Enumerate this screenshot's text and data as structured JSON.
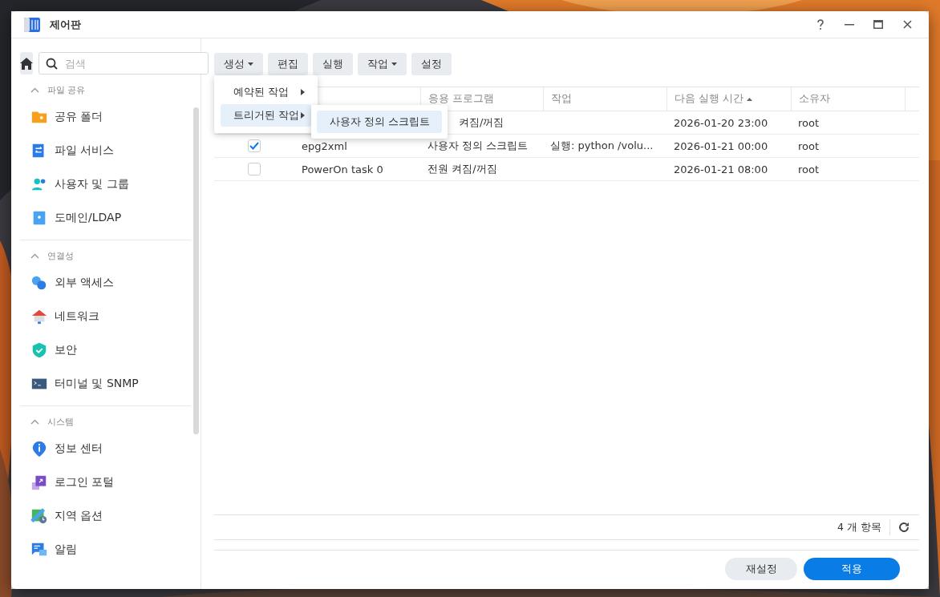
{
  "window": {
    "title": "제어판"
  },
  "sidebar": {
    "search": {
      "placeholder": "검색"
    },
    "sections": [
      {
        "title": "파일 공유",
        "expanded": true,
        "items": [
          {
            "label": "공유 폴더"
          },
          {
            "label": "파일 서비스"
          },
          {
            "label": "사용자 및 그룹"
          },
          {
            "label": "도메인/LDAP"
          }
        ]
      },
      {
        "title": "연결성",
        "expanded": true,
        "items": [
          {
            "label": "외부 액세스"
          },
          {
            "label": "네트워크"
          },
          {
            "label": "보안"
          },
          {
            "label": "터미널 및 SNMP"
          }
        ]
      },
      {
        "title": "시스템",
        "expanded": true,
        "items": [
          {
            "label": "정보 센터"
          },
          {
            "label": "로그인 포털"
          },
          {
            "label": "지역 옵션"
          },
          {
            "label": "알림"
          }
        ]
      }
    ]
  },
  "toolbar": [
    {
      "label": "생성",
      "dropdown": true
    },
    {
      "label": "편집",
      "dropdown": false
    },
    {
      "label": "실행",
      "dropdown": false
    },
    {
      "label": "작업",
      "dropdown": true
    },
    {
      "label": "설정",
      "dropdown": false
    }
  ],
  "menu": {
    "items": [
      {
        "label": "예약된 작업",
        "selected": false
      },
      {
        "label": "트리거된 작업",
        "selected": true
      }
    ],
    "submenu": [
      {
        "label": "사용자 정의 스크립트",
        "selected": true
      }
    ]
  },
  "table": {
    "columns": [
      {
        "label": "응용 프로그램",
        "sorted": false
      },
      {
        "label": "작업",
        "sorted": false
      },
      {
        "label": "다음 실행 시간",
        "sorted": true
      },
      {
        "label": "소유자",
        "sorted": false
      }
    ],
    "rows": [
      {
        "app": "켜짐/꺼짐",
        "app_covered": true,
        "next_run": "2026-01-20 23:00",
        "owner": "root"
      },
      {
        "checked": true,
        "name": "epg2xml",
        "app": "사용자 정의 스크립트",
        "task": "실행: python /volu...",
        "next_run": "2026-01-21 00:00",
        "owner": "root"
      },
      {
        "checked": false,
        "name": "PowerOn task 0",
        "app": "전원 켜짐/꺼짐",
        "next_run": "2026-01-21 08:00",
        "owner": "root"
      }
    ]
  },
  "status_bar": {
    "count": "4 개 항목"
  },
  "buttons": [
    {
      "label": "재설정",
      "kind": "secondary"
    },
    {
      "label": "적용",
      "kind": "primary"
    }
  ]
}
